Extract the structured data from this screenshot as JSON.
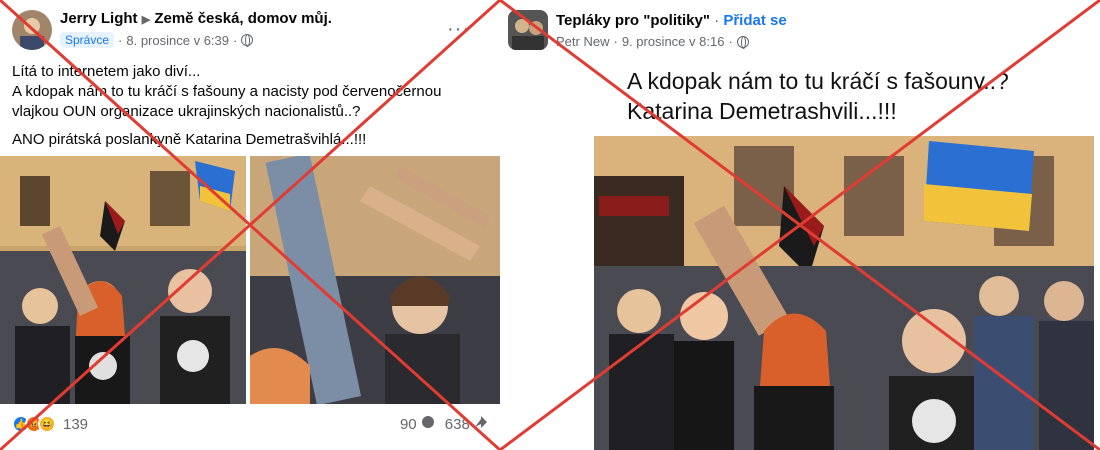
{
  "left_post": {
    "author": "Jerry Light",
    "group": "Země česká, domov můj.",
    "role_badge": "Správce",
    "timestamp": "8. prosince v 6:39",
    "text_line1": "Lítá to internetem jako diví...",
    "text_line2": "A kdopak nám to tu kráčí s fašouny a nacisty pod červenočernou vlajkou OUN organizace ukrajinských nacionalistů..?",
    "text_line3": "ANO pirátská poslankyně Katarina Demetrašvihlá...!!!",
    "reaction_count": "139",
    "comment_count": "90",
    "share_count": "638"
  },
  "right_post": {
    "group": "Tepláky pro \"politiky\"",
    "join_label": "Přidat se",
    "author": "Petr New",
    "timestamp": "9. prosince v 8:16",
    "headline_line1": "A kdopak nám to tu kráčí s fašouny..?",
    "headline_line2": "Katarina Demetrashvili...!!!"
  },
  "icons": [
    "like-icon",
    "angry-icon",
    "haha-icon",
    "comment-icon",
    "share-icon",
    "globe-icon",
    "more-icon"
  ],
  "colors": {
    "cross_red": "#e03c31",
    "link_blue": "#1877f2",
    "meta_gray": "#65676b"
  }
}
